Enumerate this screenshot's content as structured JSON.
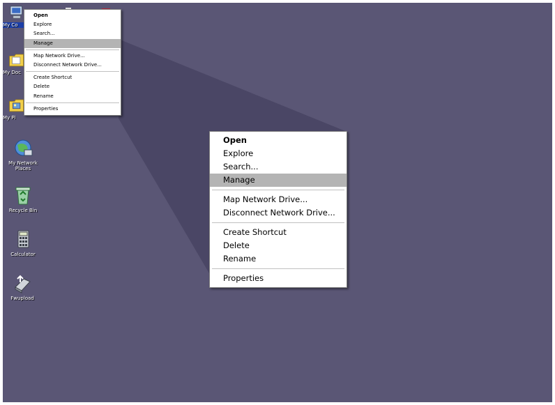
{
  "desktop": {
    "background": "#5a5675",
    "icons": [
      {
        "label": "My Co",
        "icon": "my-computer-icon"
      },
      {
        "label": "My Doc",
        "icon": "my-documents-icon"
      },
      {
        "label": "My Pi",
        "icon": "my-pictures-icon"
      },
      {
        "label": "My Network Places",
        "icon": "my-network-places-icon"
      },
      {
        "label": "Recycle Bin",
        "icon": "recycle-bin-icon"
      },
      {
        "label": "Calculator",
        "icon": "calculator-icon"
      },
      {
        "label": "Fwupload",
        "icon": "fwupload-icon"
      }
    ]
  },
  "context_menu": {
    "items": [
      {
        "label": "Open",
        "bold": true
      },
      {
        "label": "Explore"
      },
      {
        "label": "Search..."
      },
      {
        "label": "Manage",
        "highlighted": true
      },
      {
        "label": "Map Network Drive..."
      },
      {
        "label": "Disconnect Network Drive..."
      },
      {
        "label": "Create Shortcut"
      },
      {
        "label": "Delete"
      },
      {
        "label": "Rename"
      },
      {
        "label": "Properties"
      }
    ]
  }
}
